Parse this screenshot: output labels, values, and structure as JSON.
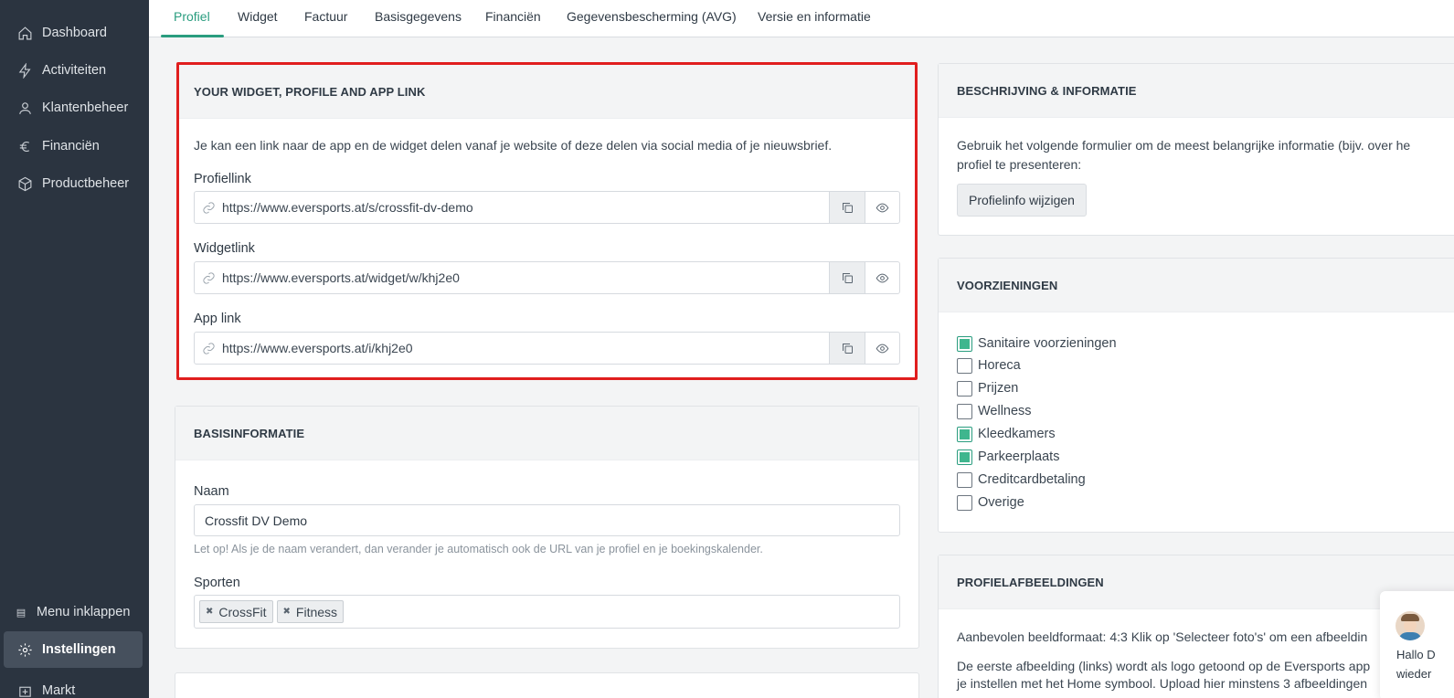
{
  "sidebar": {
    "items": [
      {
        "label": "Dashboard",
        "icon": "home-icon"
      },
      {
        "label": "Activiteiten",
        "icon": "lightning-icon"
      },
      {
        "label": "Klantenbeheer",
        "icon": "user-icon"
      },
      {
        "label": "Financiën",
        "icon": "euro-icon"
      },
      {
        "label": "Productbeheer",
        "icon": "box-icon"
      }
    ],
    "collapse_label": "Menu inklappen",
    "active_label": "Instellingen",
    "partial_label": "Markt"
  },
  "tabs": [
    "Profiel",
    "Widget",
    "Factuur",
    "Basisgegevens",
    "Financiën",
    "Gegevensbescherming (AVG)",
    "Versie en informatie"
  ],
  "links_card": {
    "title": "YOUR WIDGET, PROFILE AND APP LINK",
    "description": "Je kan een link naar de app en de widget delen vanaf je website of deze delen via social media of je nieuwsbrief.",
    "profile_label": "Profiellink",
    "profile_url": "https://www.eversports.at/s/crossfit-dv-demo",
    "widget_label": "Widgetlink",
    "widget_url": "https://www.eversports.at/widget/w/khj2e0",
    "app_label": "App link",
    "app_url": "https://www.eversports.at/i/khj2e0"
  },
  "basis_card": {
    "title": "BASISINFORMATIE",
    "name_label": "Naam",
    "name_value": "Crossfit DV Demo",
    "name_hint": "Let op! Als je de naam verandert, dan verander je automatisch ook de URL van je profiel en je boekingskalender.",
    "sports_label": "Sporten",
    "sports": [
      "CrossFit",
      "Fitness"
    ]
  },
  "beschrijving_card": {
    "title": "BESCHRIJVING & INFORMATIE",
    "text_line1": "Gebruik het volgende formulier om de meest belangrijke informatie (bijv. over he",
    "text_line2": "profiel te presenteren:",
    "button_label": "Profielinfo wijzigen"
  },
  "voorzieningen_card": {
    "title": "VOORZIENINGEN",
    "items": [
      {
        "label": "Sanitaire voorzieningen",
        "checked": true
      },
      {
        "label": "Horeca",
        "checked": false
      },
      {
        "label": "Prijzen",
        "checked": false
      },
      {
        "label": "Wellness",
        "checked": false
      },
      {
        "label": "Kleedkamers",
        "checked": true
      },
      {
        "label": "Parkeerplaats",
        "checked": true
      },
      {
        "label": "Creditcardbetaling",
        "checked": false
      },
      {
        "label": "Overige",
        "checked": false
      }
    ]
  },
  "afbeeldingen_card": {
    "title": "PROFIELAFBEELDINGEN",
    "line1": "Aanbevolen beeldformaat: 4:3 Klik op 'Selecteer foto's' om een afbeeldin",
    "line2": "De eerste afbeelding (links) wordt als logo getoond op de Eversports app",
    "line3": "je instellen met het Home symbool. Upload hier minstens 3 afbeeldingen"
  },
  "chat": {
    "line1": "Hallo D",
    "line2": "wieder"
  }
}
